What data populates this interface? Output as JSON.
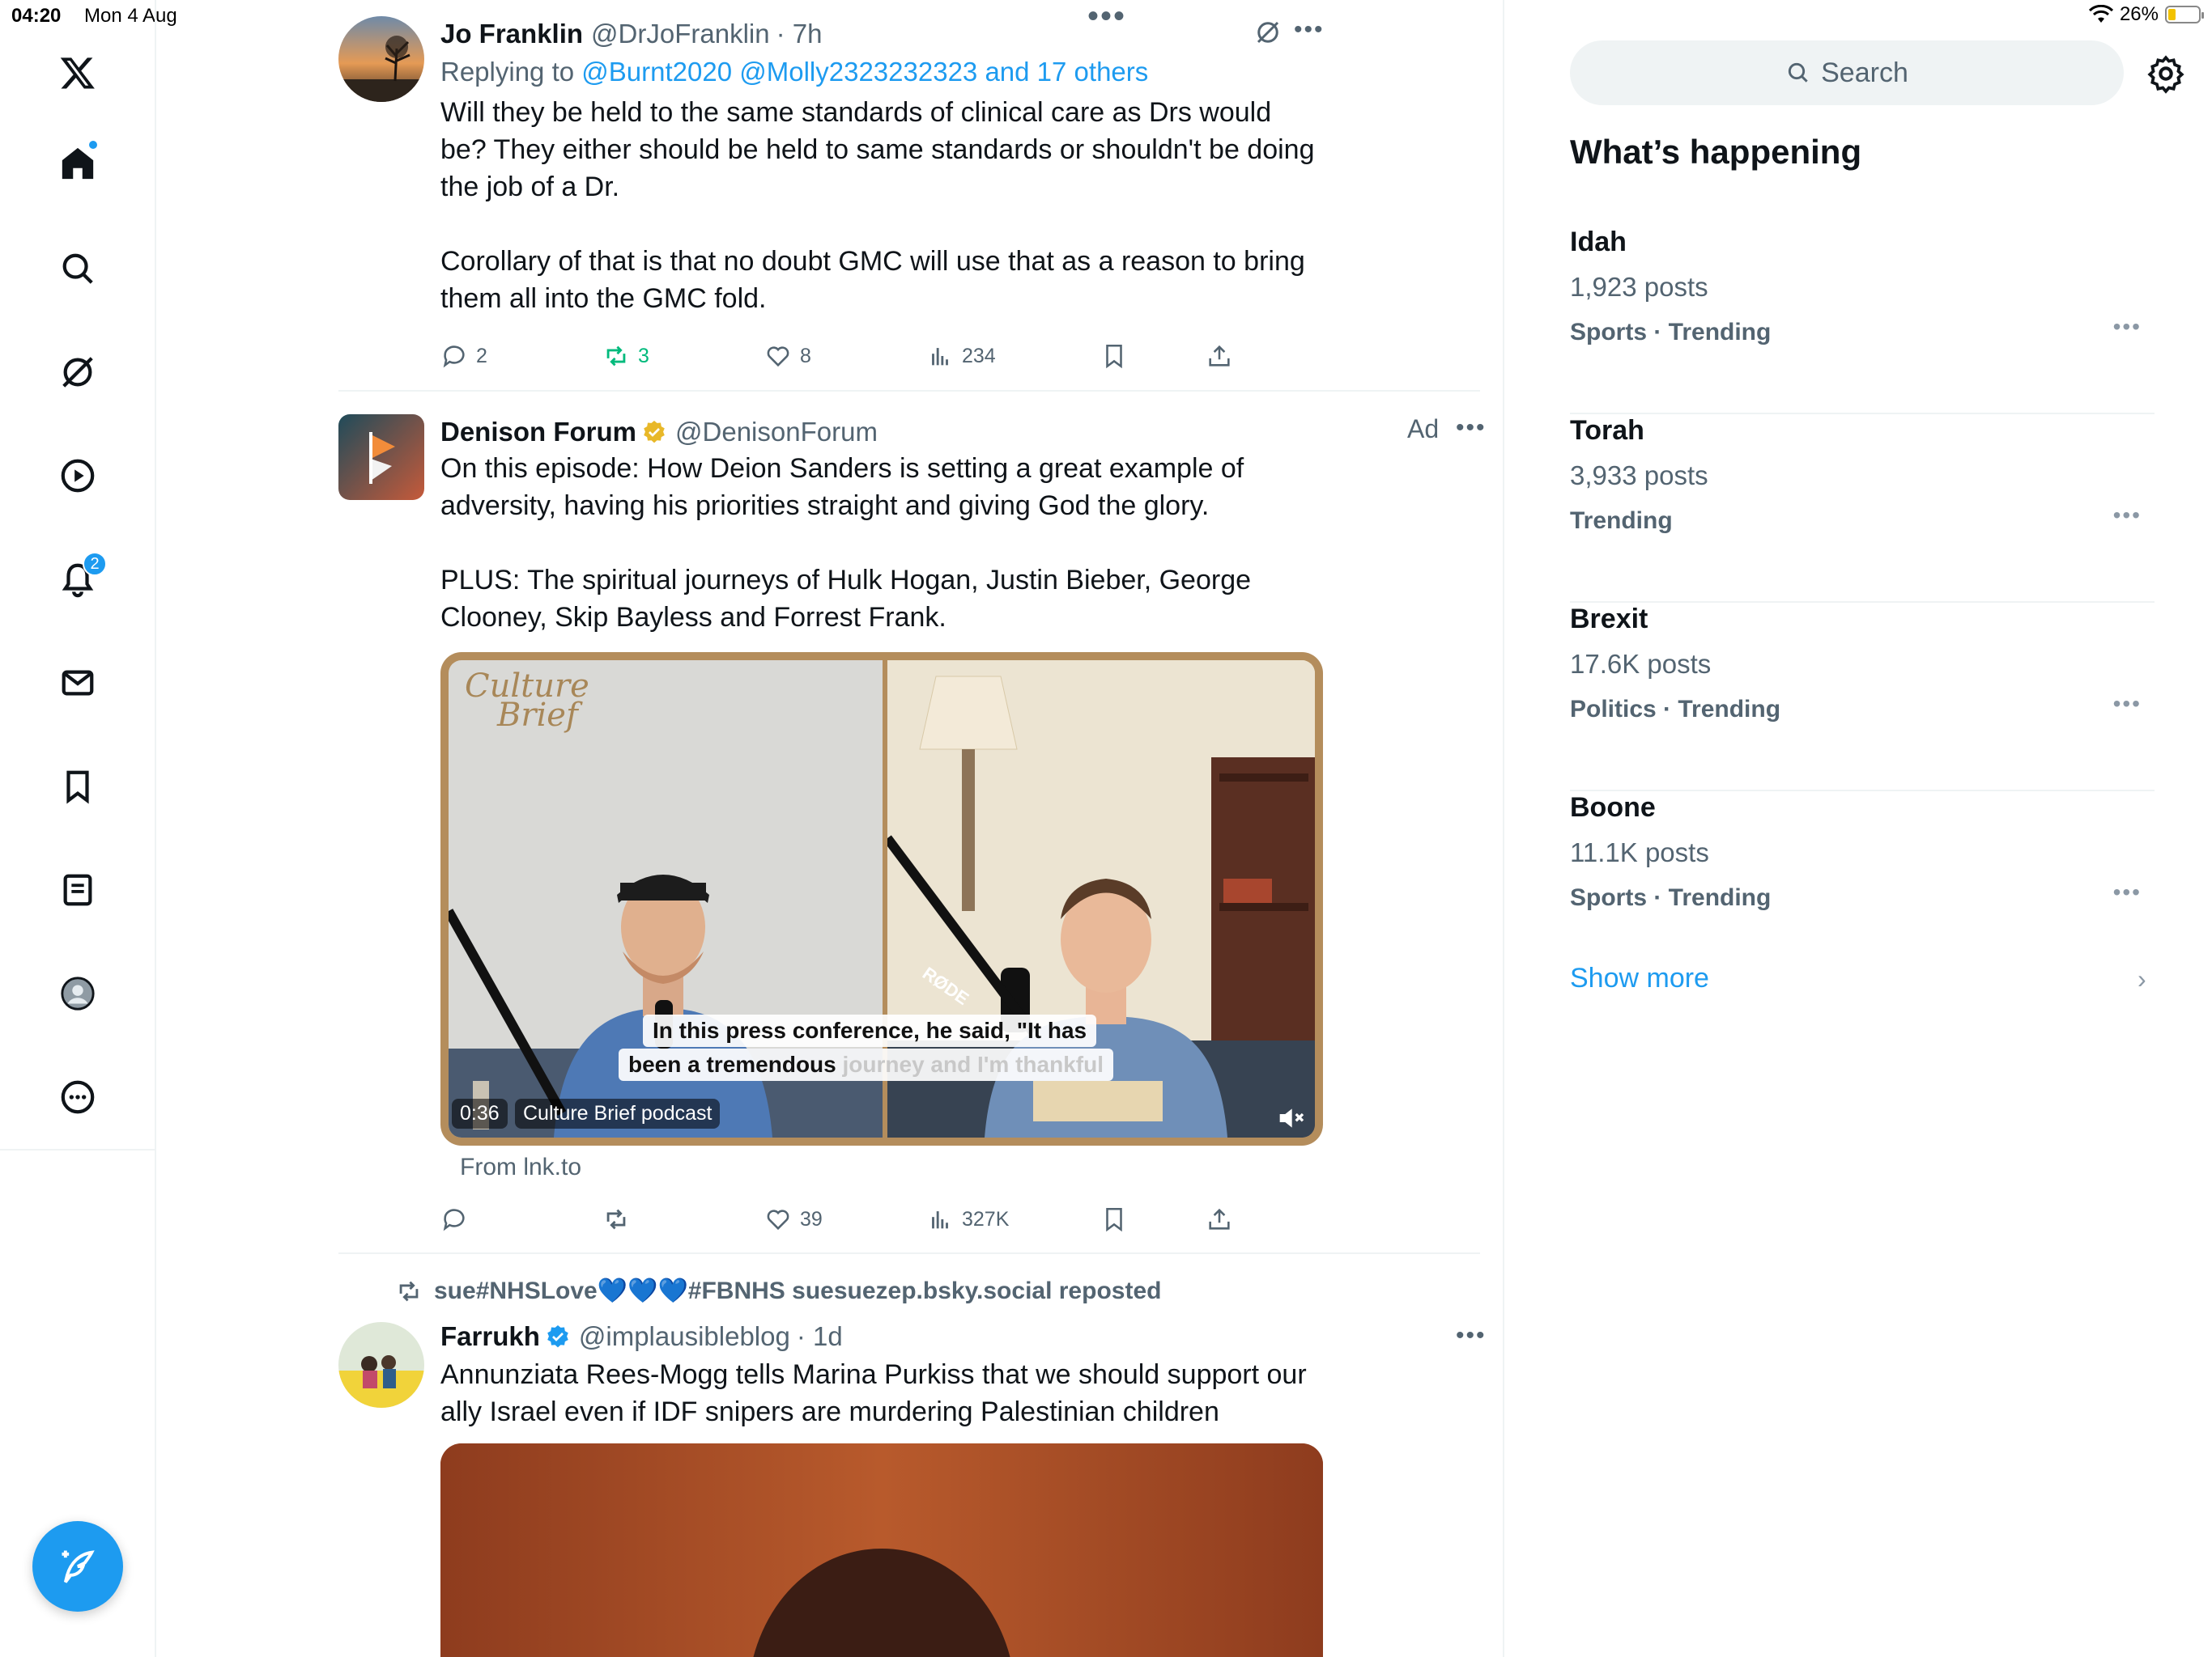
{
  "status_bar": {
    "time": "04:20",
    "date": "Mon 4 Aug",
    "battery": "26%",
    "battery_level": 0.26
  },
  "nav": {
    "items": [
      "x-logo",
      "home",
      "search",
      "grok",
      "video",
      "notifications",
      "messages",
      "bookmarks",
      "lists",
      "profile",
      "more"
    ],
    "notifications_badge": "2"
  },
  "tweets": [
    {
      "name": "Jo Franklin",
      "handle": "@DrJoFranklin",
      "time": "· 7h",
      "replying_prefix": "Replying to",
      "replying_to": "@Burnt2020 @Molly2323232323 and 17 others",
      "text": "Will they be held to the same standards of clinical care as Drs would be? They either should be held to same standards or shouldn't be doing the job of a Dr.\n\nCorollary of that is that no doubt GMC will use that as a reason to bring them all into the GMC fold.",
      "replies": "2",
      "reposts": "3",
      "likes": "8",
      "views": "234"
    },
    {
      "name": "Denison Forum",
      "handle": "@DenisonForum",
      "ad_label": "Ad",
      "text": "On this episode: How Deion Sanders is setting a great example of adversity, having his priorities straight and giving God the glory.\n\nPLUS: The spiritual journeys of Hulk Hogan, Justin Bieber, George Clooney, Skip Bayless and Forrest Frank.",
      "media": {
        "logo_line1": "Culture",
        "logo_line2": "Brief",
        "caption_line1": "In this press conference, he said, \"It has",
        "caption_line2_bold": "been a tremendous",
        "caption_line2_faded": "journey and I'm thankful",
        "duration": "0:36",
        "label": "Culture Brief podcast",
        "mic_brand": "RØDE"
      },
      "source": "From lnk.to",
      "replies": "",
      "reposts": "",
      "likes": "39",
      "views": "327K"
    },
    {
      "repost_by": "sue#NHSLove💙💙💙#FBNHS suesuezep.bsky.social reposted",
      "name": "Farrukh",
      "handle": "@implausibleblog",
      "time": "· 1d",
      "text": "Annunziata Rees-Mogg tells Marina Purkiss that we should support our ally Israel even if IDF snipers are murdering Palestinian children"
    }
  ],
  "sidebar": {
    "search_placeholder": "Search",
    "title": "What’s happening",
    "trends": [
      {
        "name": "Idah",
        "posts": "1,923 posts",
        "category": "Sports · Trending"
      },
      {
        "name": "Torah",
        "posts": "3,933 posts",
        "category": "Trending"
      },
      {
        "name": "Brexit",
        "posts": "17.6K posts",
        "category": "Politics · Trending"
      },
      {
        "name": "Boone",
        "posts": "11.1K posts",
        "category": "Sports · Trending"
      }
    ],
    "show_more": "Show more"
  },
  "colors": {
    "accent": "#1d9bf0",
    "repost_green": "#00ba7c",
    "secondary_text": "#536471",
    "verified_gold": "#e8b829"
  }
}
